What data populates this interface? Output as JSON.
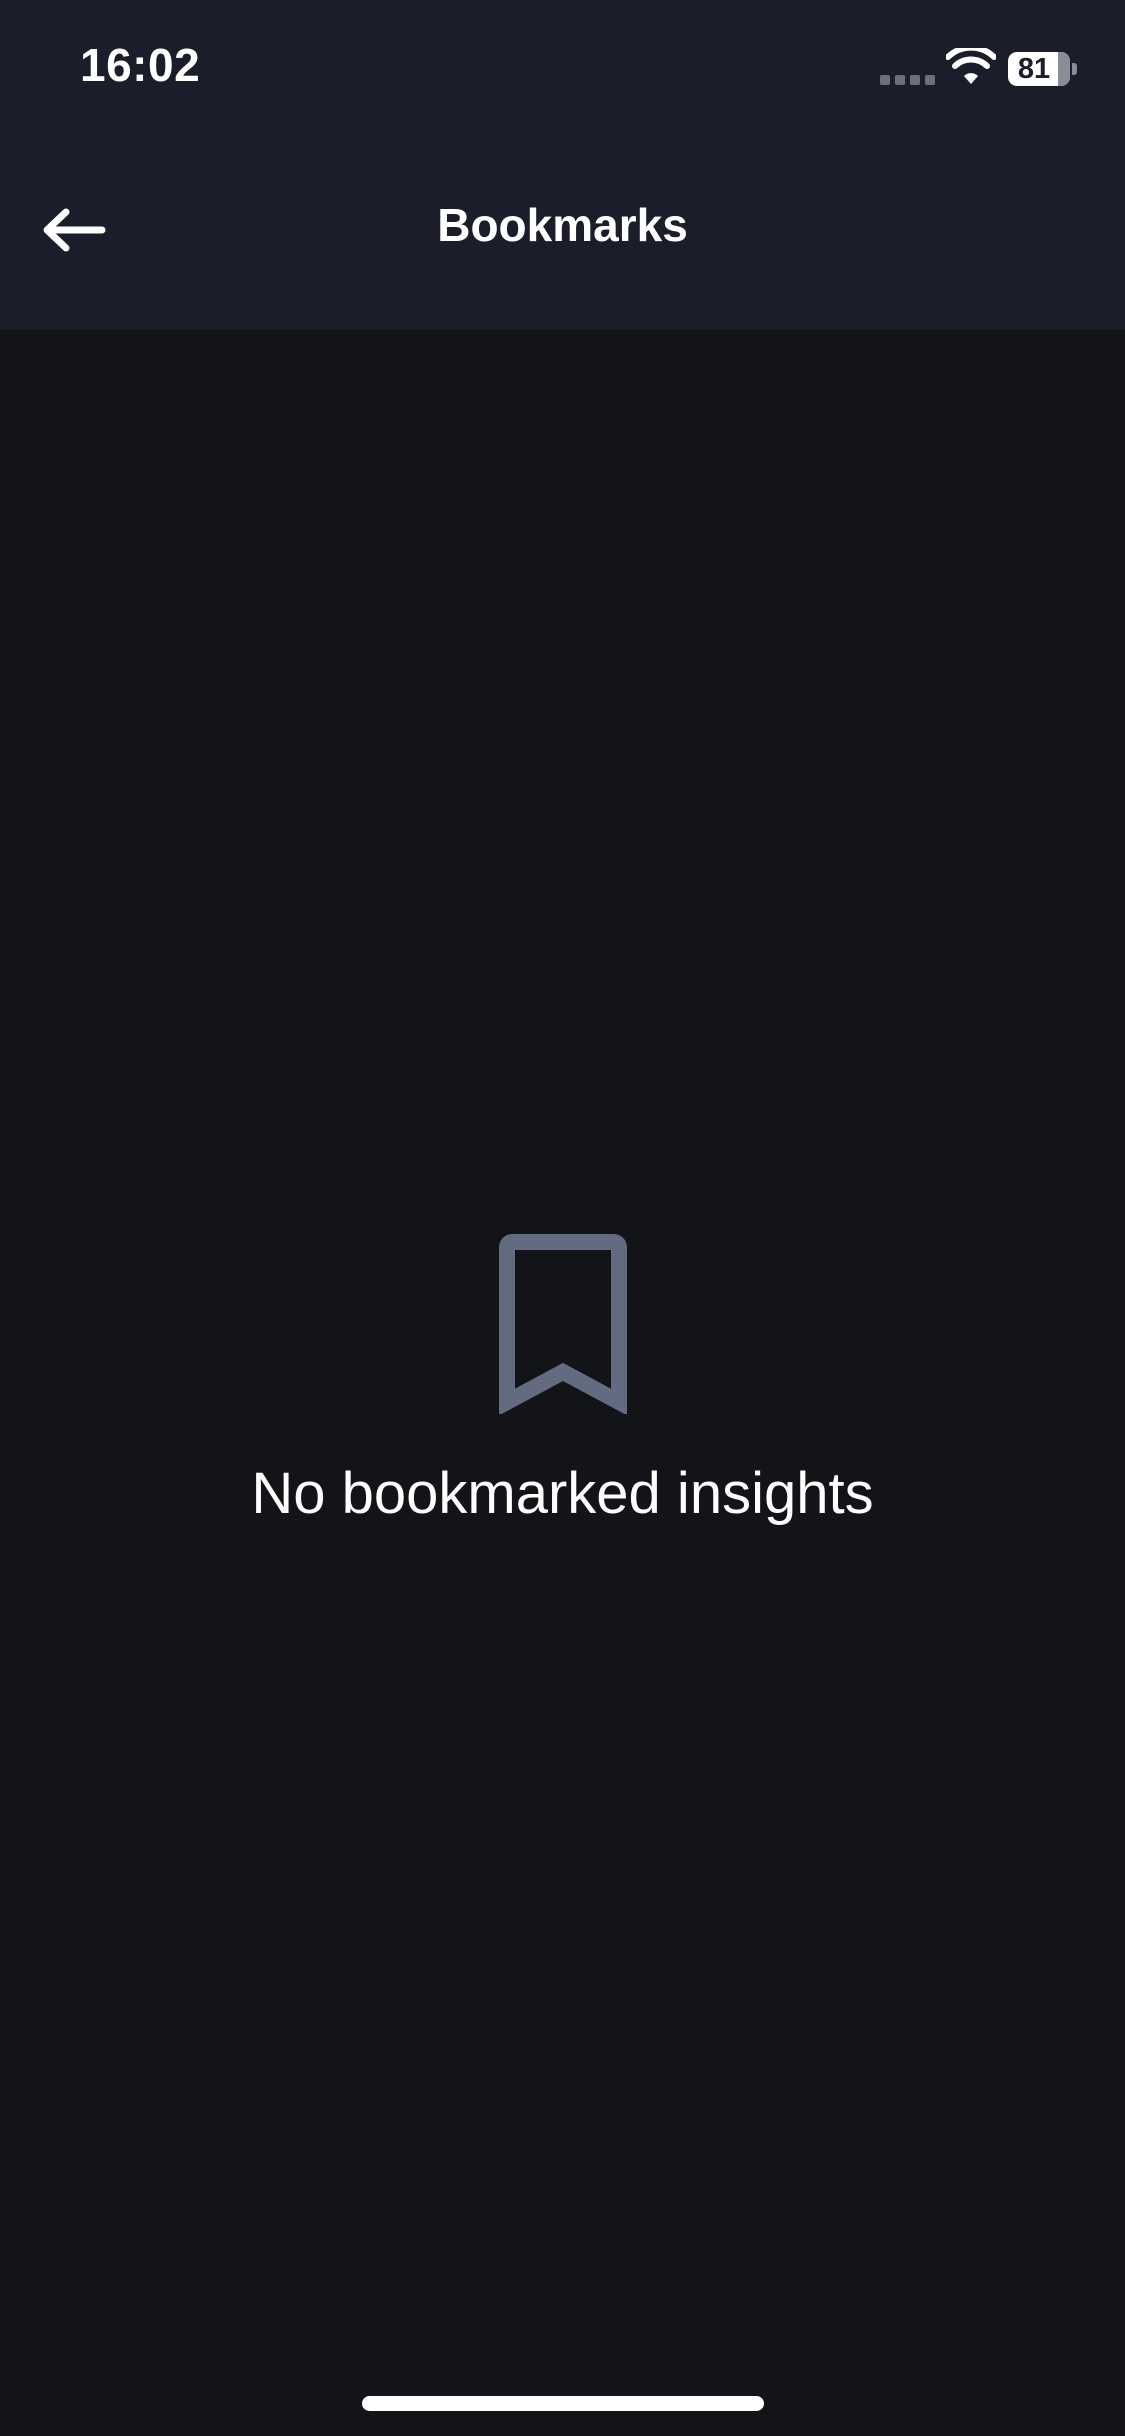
{
  "status_bar": {
    "time": "16:02",
    "battery_level": "81",
    "icons": [
      "cellular-signal-icon",
      "wifi-icon",
      "battery-icon"
    ]
  },
  "header": {
    "back_icon": "arrow-left-icon",
    "title": "Bookmarks"
  },
  "empty_state": {
    "icon": "bookmark-icon",
    "message": "No bookmarked insights"
  },
  "colors": {
    "header_background": "#1b1e2a",
    "page_background": "#131418",
    "icon_muted": "#636b80",
    "text_primary": "#ffffff"
  }
}
